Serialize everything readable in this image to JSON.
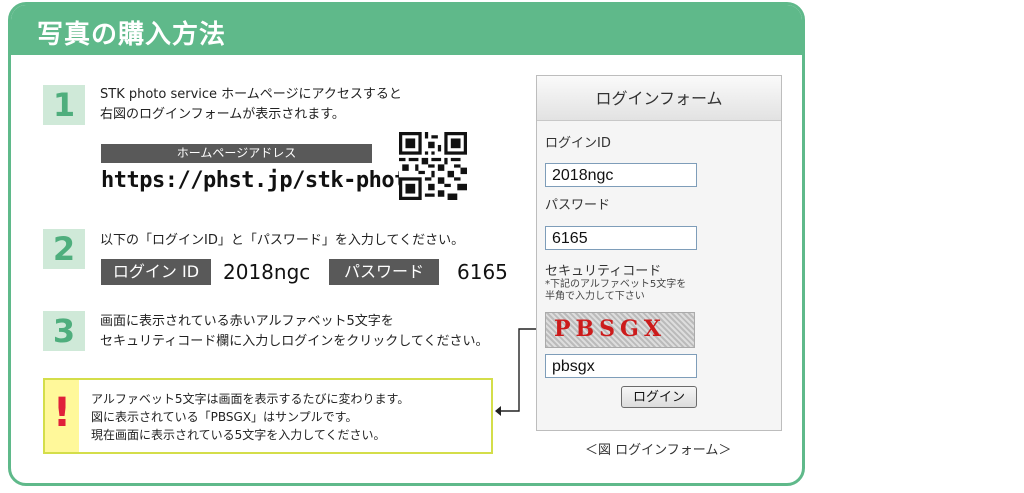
{
  "header": {
    "title": "写真の購入方法"
  },
  "steps": [
    {
      "num": "1",
      "lines": [
        "STK photo service ホームページにアクセスすると",
        "右図のログインフォームが表示されます。"
      ]
    },
    {
      "num": "2",
      "lines": [
        "以下の「ログインID」と「パスワード」を入力してください。"
      ]
    },
    {
      "num": "3",
      "lines": [
        "画面に表示されている赤いアルファベット5文字を",
        "セキュリティコード欄に入力しログインをクリックしてください。"
      ]
    }
  ],
  "address": {
    "label": "ホームページアドレス",
    "url": "https://phst.jp/stk-photo/"
  },
  "credentials": {
    "id_label": "ログイン ID",
    "id_value": "2018ngc",
    "pw_label": "パスワード",
    "pw_value": "6165"
  },
  "warning": {
    "mark": "!",
    "lines": [
      "アルファベット5文字は画面を表示するたびに変わります。",
      "図に表示されている「PBSGX」はサンプルです。",
      "現在画面に表示されている5文字を入力してください。"
    ]
  },
  "login_form": {
    "title": "ログインフォーム",
    "id_label": "ログインID",
    "id_value": "2018ngc",
    "pw_label": "パスワード",
    "pw_value": "6165",
    "code_label": "セキュリティコード",
    "code_note": [
      "*下記のアルファベット5文字を",
      "半角で入力して下さい"
    ],
    "captcha": "PBSGX",
    "code_value": "pbsgx",
    "button": "ログイン",
    "caption": "＜図 ログインフォーム＞"
  },
  "colors": {
    "accent": "#5fb98a",
    "step_bg": "#cfe9d8",
    "warning_red": "#e0203a",
    "warning_bg": "#fff89a"
  }
}
